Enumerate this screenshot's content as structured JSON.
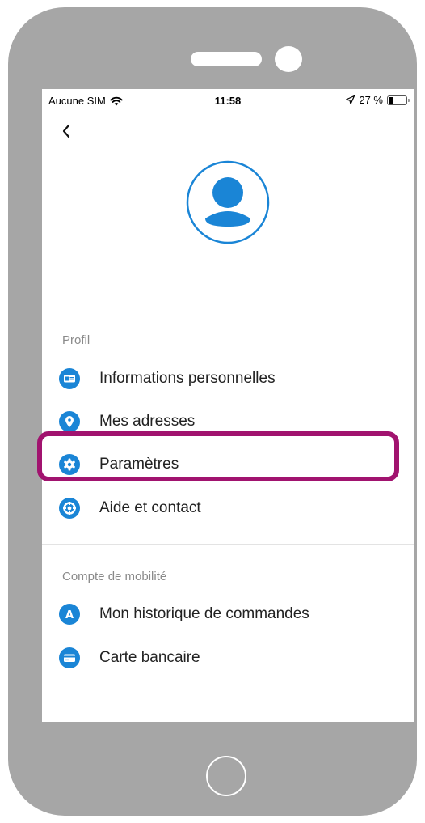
{
  "status_bar": {
    "carrier": "Aucune SIM",
    "time": "11:58",
    "battery": "27 %",
    "battery_level": 0.27,
    "wifi_icon": "wifi-icon",
    "location_icon": "location-arrow-icon"
  },
  "header": {
    "back_icon": "chevron-left-icon",
    "avatar_icon": "user-avatar-icon"
  },
  "sections": [
    {
      "title": "Profil",
      "items": [
        {
          "label": "Informations personnelles",
          "icon": "id-card-icon"
        },
        {
          "label": "Mes adresses",
          "icon": "map-pin-icon"
        },
        {
          "label": "Paramètres",
          "icon": "gear-icon",
          "highlighted": true
        },
        {
          "label": "Aide et contact",
          "icon": "lifebuoy-icon"
        }
      ]
    },
    {
      "title": "Compte de mobilité",
      "items": [
        {
          "label": "Mon historique de commandes",
          "icon": "history-icon"
        },
        {
          "label": "Carte bancaire",
          "icon": "credit-card-icon"
        }
      ]
    }
  ],
  "colors": {
    "accent": "#1a85d6",
    "highlight": "#a1136f",
    "device": "#a6a6a6"
  }
}
